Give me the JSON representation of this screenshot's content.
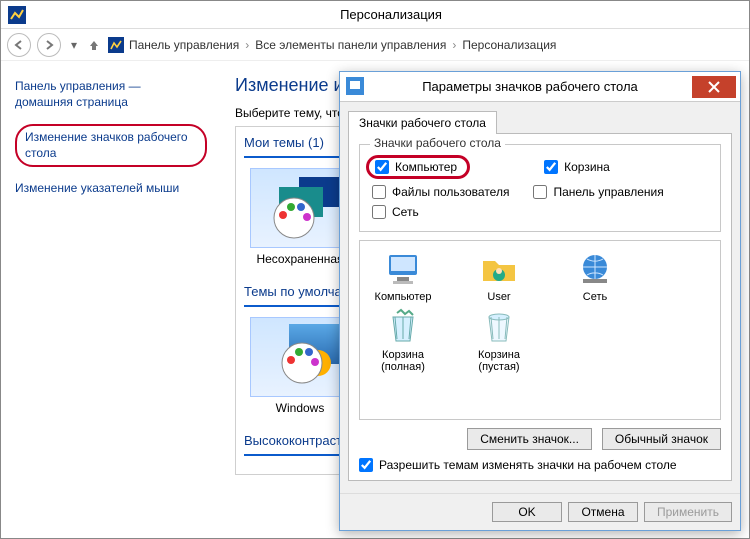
{
  "window": {
    "title": "Персонализация"
  },
  "breadcrumb": {
    "seg1": "Панель управления",
    "seg2": "Все элементы панели управления",
    "seg3": "Персонализация"
  },
  "sidebar": {
    "home_l1": "Панель управления —",
    "home_l2": "домашняя страница",
    "desktop_icons": "Изменение значков рабочего стола",
    "pointers": "Изменение указателей мыши"
  },
  "main": {
    "heading": "Изменение изо",
    "sub": "Выберите тему, что",
    "my_themes": "Мои темы (1)",
    "theme_unsaved": "Несохраненная",
    "default_themes": "Темы по умолча",
    "theme_windows": "Windows",
    "high_contrast": "Высококонтрастн"
  },
  "dialog": {
    "title": "Параметры значков рабочего стола",
    "tab": "Значки рабочего стола",
    "group": "Значки рабочего стола",
    "chk_computer": "Компьютер",
    "chk_recycle": "Корзина",
    "chk_userfiles": "Файлы пользователя",
    "chk_cpanel": "Панель управления",
    "chk_network": "Сеть",
    "icon_computer": "Компьютер",
    "icon_user": "User",
    "icon_network": "Сеть",
    "icon_recycle_full": "Корзина (полная)",
    "icon_recycle_empty": "Корзина (пустая)",
    "btn_change": "Сменить значок...",
    "btn_default": "Обычный значок",
    "allow": "Разрешить темам изменять значки на рабочем столе",
    "ok": "OK",
    "cancel": "Отмена",
    "apply": "Применить"
  }
}
